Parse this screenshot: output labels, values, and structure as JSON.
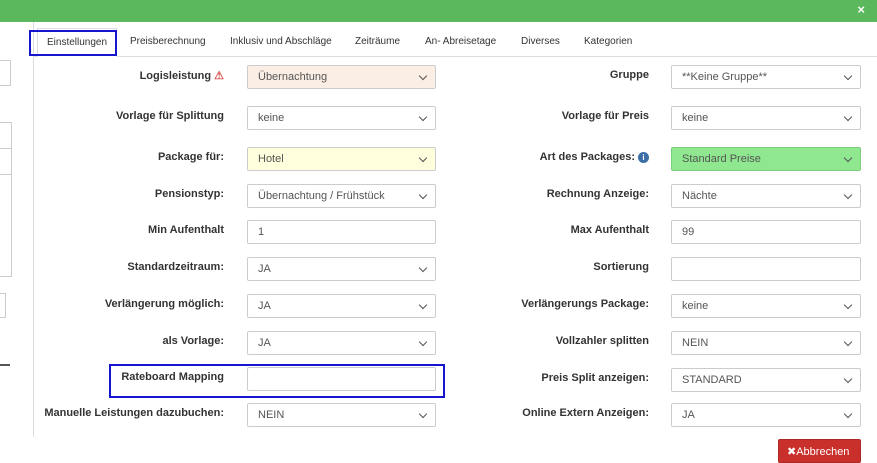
{
  "header": {
    "close_icon": "×"
  },
  "tabs": [
    "Einstellungen",
    "Preisberechnung",
    "Inklusiv und Abschläge",
    "Zeiträume",
    "An- Abreisetage",
    "Diverses",
    "Kategorien"
  ],
  "form": {
    "logisleistung": {
      "label": "Logisleistung",
      "warn_icon": "⚠",
      "value": "Übernachtung"
    },
    "gruppe": {
      "label": "Gruppe",
      "value": "**Keine Gruppe**"
    },
    "vorlage_splittung": {
      "label": "Vorlage für Splittung",
      "value": "keine"
    },
    "vorlage_preis": {
      "label": "Vorlage für Preis",
      "value": "keine"
    },
    "package_fuer": {
      "label": "Package für:",
      "value": "Hotel"
    },
    "art_package": {
      "label": "Art des Packages:",
      "info_icon": "i",
      "value": "Standard Preise"
    },
    "pensionstyp": {
      "label": "Pensionstyp:",
      "value": "Übernachtung / Frühstück"
    },
    "rechnung_anzeige": {
      "label": "Rechnung Anzeige:",
      "value": "Nächte"
    },
    "min_aufenthalt": {
      "label": "Min Aufenthalt",
      "value": "1"
    },
    "max_aufenthalt": {
      "label": "Max Aufenthalt",
      "value": "99"
    },
    "standardzeitraum": {
      "label": "Standardzeitraum:",
      "value": "JA"
    },
    "sortierung": {
      "label": "Sortierung",
      "value": ""
    },
    "verlaengerung": {
      "label": "Verlängerung möglich:",
      "value": "JA"
    },
    "verlaengerungs_package": {
      "label": "Verlängerungs Package:",
      "value": "keine"
    },
    "als_vorlage": {
      "label": "als Vorlage:",
      "value": "JA"
    },
    "vollzahler": {
      "label": "Vollzahler splitten",
      "value": "NEIN"
    },
    "rateboard": {
      "label": "Rateboard Mapping",
      "value": ""
    },
    "preis_split": {
      "label": "Preis Split anzeigen:",
      "value": "STANDARD"
    },
    "manuelle": {
      "label": "Manuelle Leistungen dazubuchen:",
      "value": "NEIN"
    },
    "online_extern": {
      "label": "Online Extern Anzeigen:",
      "value": "JA"
    }
  },
  "footer": {
    "cancel_icon": "✖",
    "cancel_label": "Abbrechen"
  },
  "colors": {
    "header": "#5cb85c",
    "cancel": "#c9302c",
    "highlight": "#1515d0",
    "green_select": "#8fe88f"
  }
}
